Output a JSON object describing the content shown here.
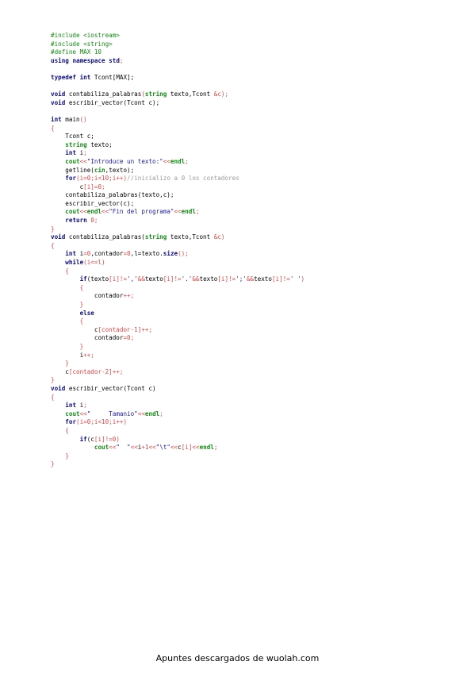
{
  "document": {
    "code_lines": [
      [
        [
          "pp",
          "#include <iostream>"
        ]
      ],
      [
        [
          "pp",
          "#include <string>"
        ]
      ],
      [
        [
          "pp",
          "#define MAX 10"
        ]
      ],
      [
        [
          "kw",
          "using"
        ],
        [
          "sp",
          " "
        ],
        [
          "kw",
          "namespace"
        ],
        [
          "sp",
          " "
        ],
        [
          "kw",
          "std"
        ],
        [
          "op",
          ";"
        ]
      ],
      [],
      [
        [
          "kw",
          "typedef"
        ],
        [
          "sp",
          " "
        ],
        [
          "kw",
          "int"
        ],
        [
          "sp",
          " "
        ],
        [
          "id",
          "Tcont[MAX];"
        ]
      ],
      [],
      [
        [
          "kw",
          "void"
        ],
        [
          "sp",
          " "
        ],
        [
          "id",
          "contabiliza_palabras"
        ],
        [
          "op",
          "("
        ],
        [
          "ty",
          "string"
        ],
        [
          "sp",
          " "
        ],
        [
          "id",
          "texto,Tcont "
        ],
        [
          "op",
          "&c);"
        ]
      ],
      [
        [
          "kw",
          "void"
        ],
        [
          "sp",
          " "
        ],
        [
          "id",
          "escribir_vector(Tcont c);"
        ]
      ],
      [],
      [
        [
          "kw",
          "int"
        ],
        [
          "sp",
          " "
        ],
        [
          "id",
          "main"
        ],
        [
          "op",
          "()"
        ]
      ],
      [
        [
          "op",
          "{"
        ]
      ],
      [
        [
          "sp",
          "    "
        ],
        [
          "id",
          "Tcont c;"
        ]
      ],
      [
        [
          "sp",
          "    "
        ],
        [
          "ty",
          "string"
        ],
        [
          "sp",
          " "
        ],
        [
          "id",
          "texto;"
        ]
      ],
      [
        [
          "sp",
          "    "
        ],
        [
          "kw",
          "int"
        ],
        [
          "sp",
          " "
        ],
        [
          "id",
          "i"
        ],
        [
          "op",
          ";"
        ]
      ],
      [
        [
          "sp",
          "    "
        ],
        [
          "io",
          "cout"
        ],
        [
          "op",
          "<<"
        ],
        [
          "str",
          "\"Introduce un texto:\""
        ],
        [
          "op",
          "<<"
        ],
        [
          "io",
          "endl"
        ],
        [
          "op",
          ";"
        ]
      ],
      [
        [
          "sp",
          "    "
        ],
        [
          "id",
          "getline("
        ],
        [
          "io",
          "cin"
        ],
        [
          "id",
          ",texto);"
        ]
      ],
      [
        [
          "sp",
          "    "
        ],
        [
          "ctl",
          "for"
        ],
        [
          "op",
          "(i="
        ],
        [
          "num",
          "0"
        ],
        [
          "op",
          ";i<"
        ],
        [
          "num",
          "10"
        ],
        [
          "op",
          ";i++)"
        ],
        [
          "com",
          "//inicializo a 0 los contadores"
        ]
      ],
      [
        [
          "sp",
          "        "
        ],
        [
          "id",
          "c"
        ],
        [
          "op",
          "[i]="
        ],
        [
          "num",
          "0"
        ],
        [
          "op",
          ";"
        ]
      ],
      [
        [
          "sp",
          "    "
        ],
        [
          "id",
          "contabiliza_palabras(texto,c);"
        ]
      ],
      [
        [
          "sp",
          "    "
        ],
        [
          "id",
          "escribir_vector(c);"
        ]
      ],
      [
        [
          "sp",
          "    "
        ],
        [
          "io",
          "cout"
        ],
        [
          "op",
          "<<"
        ],
        [
          "io",
          "endl"
        ],
        [
          "op",
          "<<"
        ],
        [
          "str",
          "\"Fin del programa\""
        ],
        [
          "op",
          "<<"
        ],
        [
          "io",
          "endl"
        ],
        [
          "op",
          ";"
        ]
      ],
      [
        [
          "sp",
          "    "
        ],
        [
          "ctl",
          "return"
        ],
        [
          "sp",
          " "
        ],
        [
          "num",
          "0"
        ],
        [
          "op",
          ";"
        ]
      ],
      [
        [
          "op",
          "}"
        ]
      ],
      [
        [
          "kw",
          "void"
        ],
        [
          "sp",
          " "
        ],
        [
          "id",
          "contabiliza_palabras("
        ],
        [
          "ty",
          "string"
        ],
        [
          "sp",
          " "
        ],
        [
          "id",
          "texto,Tcont "
        ],
        [
          "op",
          "&c)"
        ]
      ],
      [
        [
          "op",
          "{"
        ]
      ],
      [
        [
          "sp",
          "    "
        ],
        [
          "kw",
          "int"
        ],
        [
          "sp",
          " "
        ],
        [
          "id",
          "i"
        ],
        [
          "op",
          "="
        ],
        [
          "num",
          "0"
        ],
        [
          "id",
          ",contador"
        ],
        [
          "op",
          "="
        ],
        [
          "num",
          "0"
        ],
        [
          "id",
          ",l=texto."
        ],
        [
          "kw",
          "size"
        ],
        [
          "op",
          "();"
        ]
      ],
      [
        [
          "sp",
          "    "
        ],
        [
          "ctl",
          "while"
        ],
        [
          "op",
          "(i<=l)"
        ]
      ],
      [
        [
          "sp",
          "    "
        ],
        [
          "op",
          "{"
        ]
      ],
      [
        [
          "sp",
          "        "
        ],
        [
          "ctl",
          "if"
        ],
        [
          "id",
          "(texto"
        ],
        [
          "op",
          "[i]!="
        ],
        [
          "str",
          "','"
        ],
        [
          "op",
          "&&"
        ],
        [
          "id",
          "texto"
        ],
        [
          "op",
          "[i]!="
        ],
        [
          "str",
          "'.'"
        ],
        [
          "op",
          "&&"
        ],
        [
          "id",
          "texto"
        ],
        [
          "op",
          "[i]!="
        ],
        [
          "str",
          "';'"
        ],
        [
          "op",
          "&&"
        ],
        [
          "id",
          "texto"
        ],
        [
          "op",
          "[i]!="
        ],
        [
          "str",
          "' '"
        ],
        [
          "op",
          ")"
        ]
      ],
      [
        [
          "sp",
          "        "
        ],
        [
          "op",
          "{"
        ]
      ],
      [
        [
          "sp",
          "            "
        ],
        [
          "id",
          "contador"
        ],
        [
          "op",
          "++;"
        ]
      ],
      [
        [
          "sp",
          "        "
        ],
        [
          "op",
          "}"
        ]
      ],
      [
        [
          "sp",
          "        "
        ],
        [
          "ctl",
          "else"
        ]
      ],
      [
        [
          "sp",
          "        "
        ],
        [
          "op",
          "{"
        ]
      ],
      [
        [
          "sp",
          "            "
        ],
        [
          "id",
          "c"
        ],
        [
          "op",
          "[contador-"
        ],
        [
          "num",
          "1"
        ],
        [
          "op",
          "]++;"
        ]
      ],
      [
        [
          "sp",
          "            "
        ],
        [
          "id",
          "contador"
        ],
        [
          "op",
          "="
        ],
        [
          "num",
          "0"
        ],
        [
          "op",
          ";"
        ]
      ],
      [
        [
          "sp",
          "        "
        ],
        [
          "op",
          "}"
        ]
      ],
      [
        [
          "sp",
          "        "
        ],
        [
          "id",
          "i"
        ],
        [
          "op",
          "++;"
        ]
      ],
      [
        [
          "sp",
          "    "
        ],
        [
          "op",
          "}"
        ]
      ],
      [
        [
          "sp",
          "    "
        ],
        [
          "id",
          "c"
        ],
        [
          "op",
          "[contador-"
        ],
        [
          "num",
          "2"
        ],
        [
          "op",
          "]++;"
        ]
      ],
      [
        [
          "op",
          "}"
        ]
      ],
      [
        [
          "kw",
          "void"
        ],
        [
          "sp",
          " "
        ],
        [
          "id",
          "escribir_vector(Tcont c)"
        ]
      ],
      [
        [
          "op",
          "{"
        ]
      ],
      [
        [
          "sp",
          "    "
        ],
        [
          "kw",
          "int"
        ],
        [
          "sp",
          " "
        ],
        [
          "id",
          "i"
        ],
        [
          "op",
          ";"
        ]
      ],
      [
        [
          "sp",
          "    "
        ],
        [
          "io",
          "cout"
        ],
        [
          "op",
          "<<"
        ],
        [
          "str",
          "\"     Tamanio\""
        ],
        [
          "op",
          "<<"
        ],
        [
          "io",
          "endl"
        ],
        [
          "op",
          ";"
        ]
      ],
      [
        [
          "sp",
          "    "
        ],
        [
          "ctl",
          "for"
        ],
        [
          "op",
          "(i="
        ],
        [
          "num",
          "0"
        ],
        [
          "op",
          ";i<"
        ],
        [
          "num",
          "10"
        ],
        [
          "op",
          ";i++)"
        ]
      ],
      [
        [
          "sp",
          "    "
        ],
        [
          "op",
          "{"
        ]
      ],
      [
        [
          "sp",
          "        "
        ],
        [
          "ctl",
          "if"
        ],
        [
          "id",
          "(c"
        ],
        [
          "op",
          "[i]!="
        ],
        [
          "num",
          "0"
        ],
        [
          "op",
          ")"
        ]
      ],
      [
        [
          "sp",
          "            "
        ],
        [
          "io",
          "cout"
        ],
        [
          "op",
          "<<"
        ],
        [
          "str",
          "\"  \""
        ],
        [
          "op",
          "<<"
        ],
        [
          "id",
          "i"
        ],
        [
          "op",
          "+"
        ],
        [
          "num",
          "1"
        ],
        [
          "op",
          "<<"
        ],
        [
          "str",
          "\"\\t\""
        ],
        [
          "op",
          "<<"
        ],
        [
          "id",
          "c"
        ],
        [
          "op",
          "[i]<<"
        ],
        [
          "io",
          "endl"
        ],
        [
          "op",
          ";"
        ]
      ],
      [
        [
          "sp",
          "    "
        ],
        [
          "op",
          "}"
        ]
      ],
      [
        [
          "op",
          "}"
        ]
      ]
    ]
  },
  "footer": {
    "text": "Apuntes descargados de wuolah.com"
  }
}
